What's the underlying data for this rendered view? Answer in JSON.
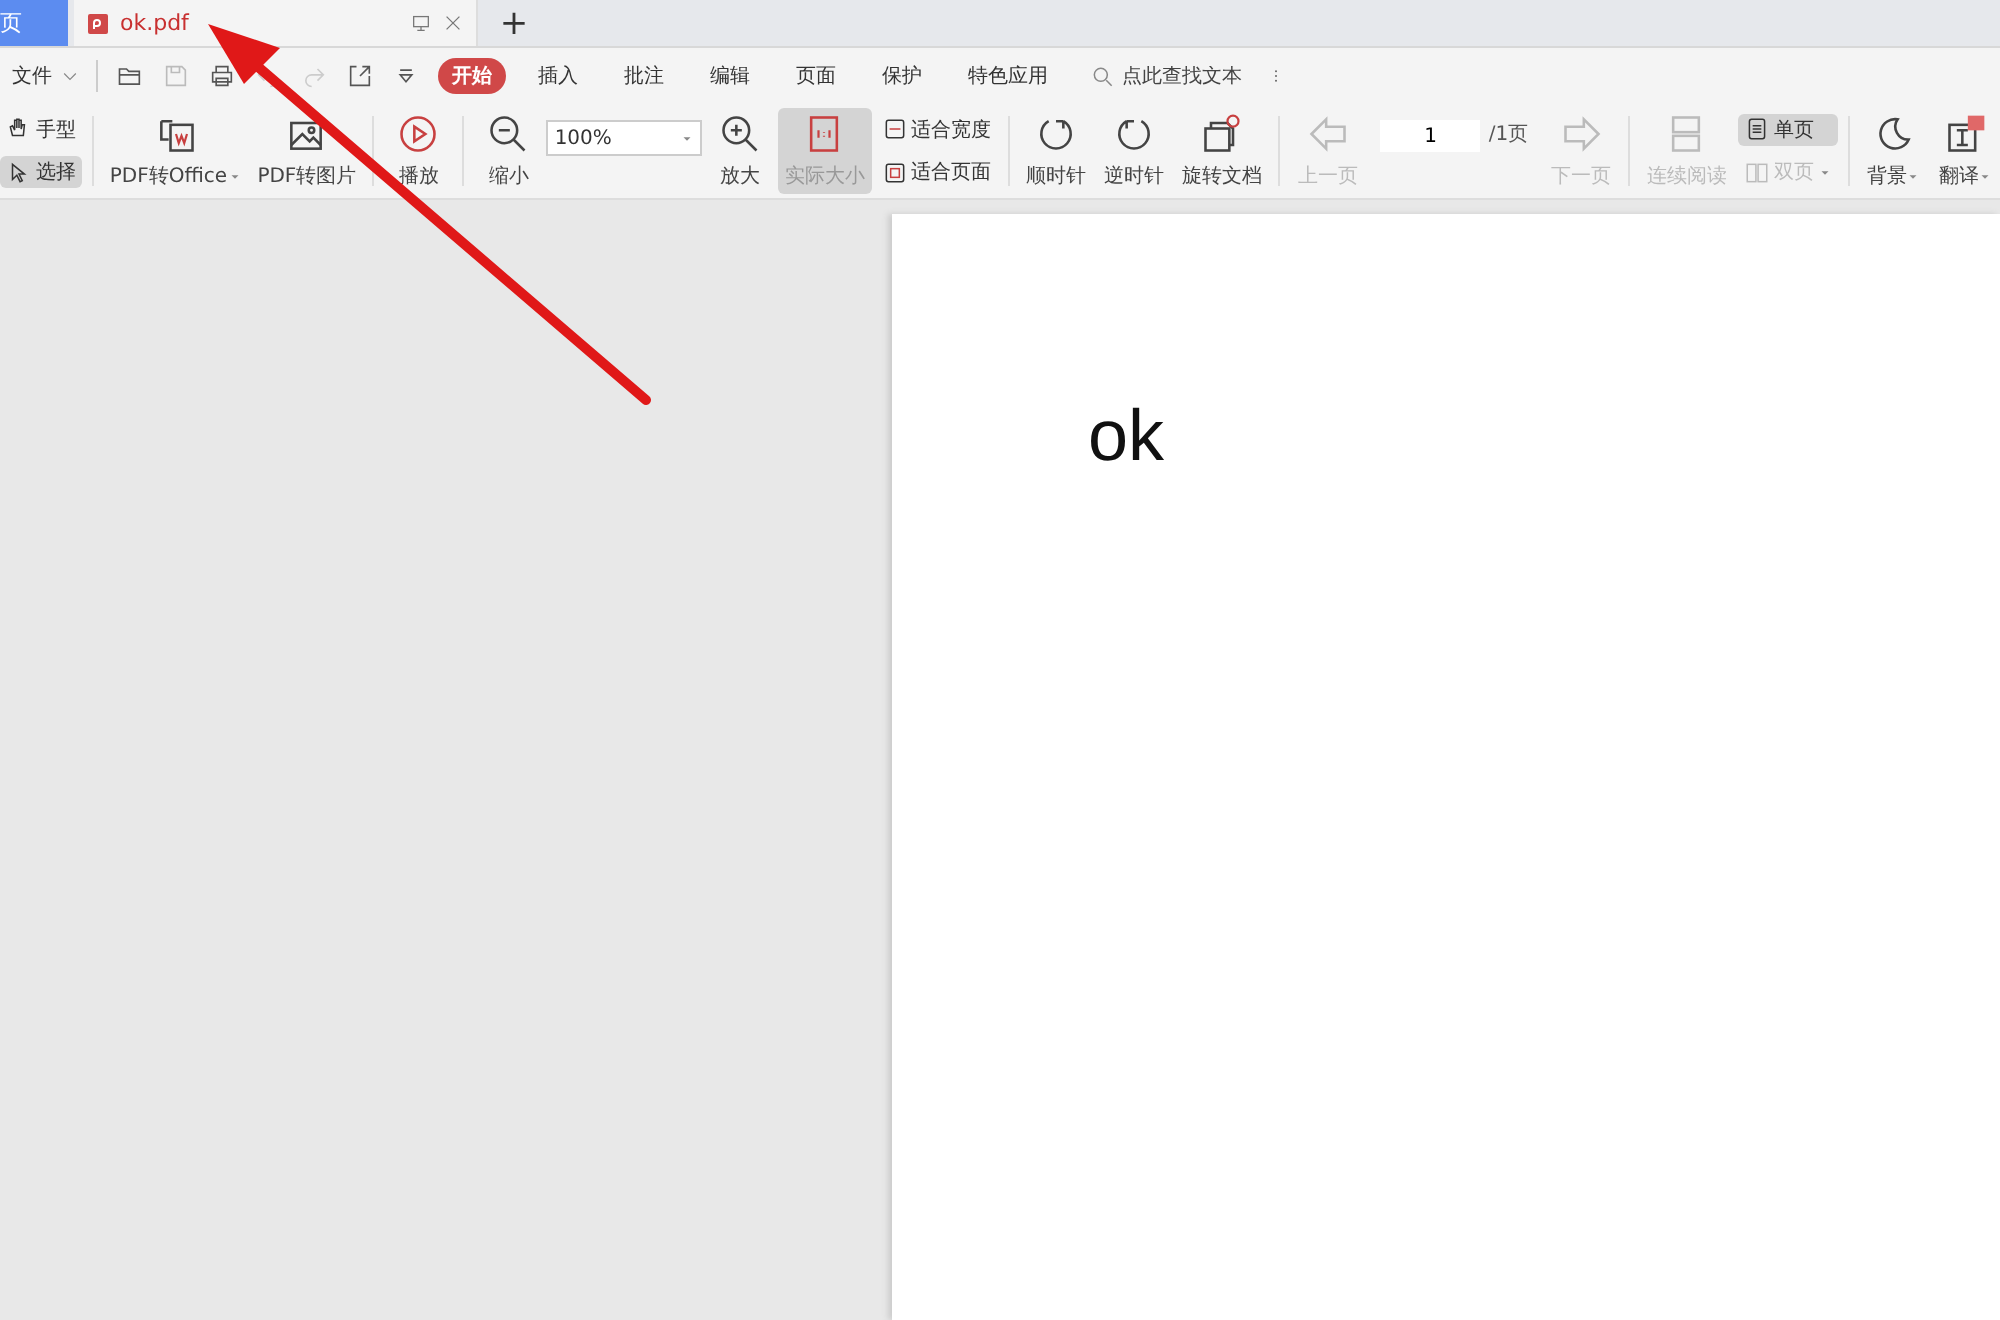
{
  "doc_tabs": [
    {
      "label": "页",
      "selected": false,
      "kind": "home"
    },
    {
      "label": "ok.pdf",
      "selected": true,
      "kind": "pdf"
    }
  ],
  "new_tab": "+",
  "menu": {
    "file": "文件",
    "tabs": [
      {
        "label": "开始",
        "selected": true
      },
      {
        "label": "插入",
        "selected": false
      },
      {
        "label": "批注",
        "selected": false
      },
      {
        "label": "编辑",
        "selected": false
      },
      {
        "label": "页面",
        "selected": false
      },
      {
        "label": "保护",
        "selected": false
      },
      {
        "label": "特色应用",
        "selected": false
      }
    ],
    "search": {
      "placeholder": "点此查找文本"
    }
  },
  "ribbon": [
    {
      "kind": "stack",
      "items": [
        {
          "label": "手型",
          "selected": false,
          "disabled": false,
          "caret": false
        },
        {
          "label": "选择",
          "selected": true,
          "disabled": false,
          "caret": false
        }
      ]
    },
    {
      "kind": "sep"
    },
    {
      "kind": "big",
      "label": "PDF转Office",
      "selected": false,
      "disabled": false,
      "caret": true
    },
    {
      "kind": "big",
      "label": "PDF转图片",
      "selected": false,
      "disabled": false,
      "caret": false
    },
    {
      "kind": "sep"
    },
    {
      "kind": "big",
      "label": "播放",
      "selected": false,
      "disabled": false,
      "caret": false
    },
    {
      "kind": "sep"
    },
    {
      "kind": "big",
      "label": "缩小",
      "selected": false,
      "disabled": false,
      "caret": false
    },
    {
      "kind": "combo",
      "value": "100%"
    },
    {
      "kind": "big",
      "label": "放大",
      "selected": false,
      "disabled": false,
      "caret": false
    },
    {
      "kind": "big",
      "label": "实际大小",
      "selected": true,
      "disabled": false,
      "caret": false
    },
    {
      "kind": "stack",
      "items": [
        {
          "label": "适合宽度",
          "selected": false,
          "disabled": false,
          "caret": false
        },
        {
          "label": "适合页面",
          "selected": false,
          "disabled": false,
          "caret": false
        }
      ]
    },
    {
      "kind": "sep"
    },
    {
      "kind": "big",
      "label": "顺时针",
      "selected": false,
      "disabled": false,
      "caret": false
    },
    {
      "kind": "big",
      "label": "逆时针",
      "selected": false,
      "disabled": false,
      "caret": false
    },
    {
      "kind": "big",
      "label": "旋转文档",
      "selected": false,
      "disabled": false,
      "caret": false
    },
    {
      "kind": "sep"
    },
    {
      "kind": "big",
      "label": "上一页",
      "selected": false,
      "disabled": true,
      "caret": false
    },
    {
      "kind": "page",
      "value": "1",
      "total": "/1页"
    },
    {
      "kind": "big",
      "label": "下一页",
      "selected": false,
      "disabled": true,
      "caret": false
    },
    {
      "kind": "sep"
    },
    {
      "kind": "big",
      "label": "连续阅读",
      "selected": false,
      "disabled": true,
      "caret": false
    },
    {
      "kind": "stack",
      "items": [
        {
          "label": "单页",
          "selected": true,
          "disabled": false,
          "caret": false
        },
        {
          "label": "双页",
          "selected": false,
          "disabled": true,
          "caret": true
        }
      ]
    },
    {
      "kind": "sep"
    },
    {
      "kind": "big",
      "label": "背景",
      "selected": false,
      "disabled": false,
      "caret": true
    },
    {
      "kind": "big",
      "label": "翻译",
      "selected": false,
      "disabled": false,
      "caret": true
    }
  ],
  "document": {
    "text": "ok"
  }
}
